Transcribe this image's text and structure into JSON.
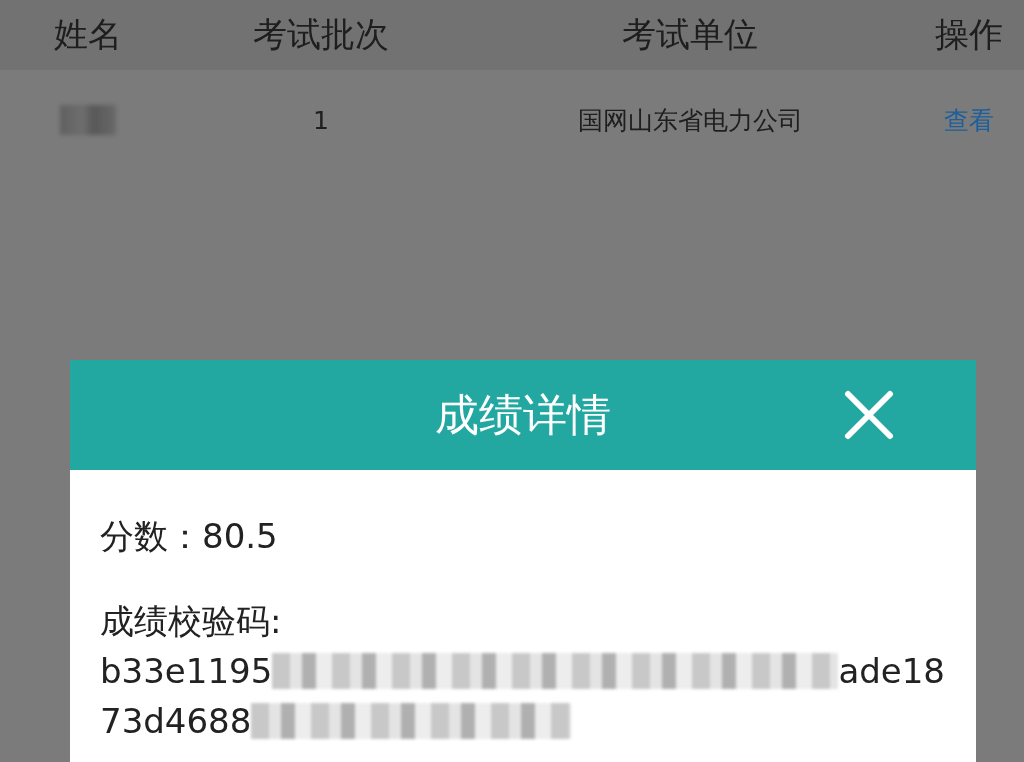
{
  "table": {
    "columns": [
      "姓名",
      "考试批次",
      "考试单位",
      "操作"
    ],
    "rows": [
      {
        "cells": [
          {
            "kind": "redacted"
          },
          {
            "kind": "text",
            "text": "1"
          },
          {
            "kind": "text",
            "text": "国网山东省电力公司"
          },
          {
            "kind": "link",
            "text": "查看"
          }
        ]
      }
    ]
  },
  "dialog": {
    "title": "成绩详情",
    "score": "分数：80.5",
    "code_label": "成绩校验码:",
    "code_lines": [
      {
        "segments": [
          {
            "kind": "text",
            "text": "b33e1195"
          },
          {
            "kind": "redacted"
          },
          {
            "kind": "text",
            "text": "ade18"
          }
        ]
      },
      {
        "segments": [
          {
            "kind": "text",
            "text": "73d4688"
          },
          {
            "kind": "redacted"
          }
        ]
      }
    ]
  }
}
